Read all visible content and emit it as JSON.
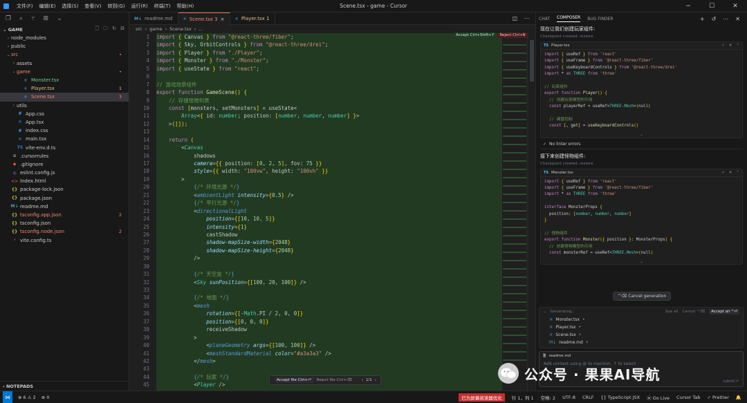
{
  "titlebar": {
    "menus": [
      "文件(F)",
      "编辑(E)",
      "选择(S)",
      "查看(V)",
      "转到(G)",
      "运行(R)",
      "终端(T)",
      "帮助(H)"
    ],
    "title": "Scene.tsx - game - Cursor"
  },
  "explorer": {
    "section": "GAME",
    "outline": "NOTEPADS",
    "items": [
      {
        "label": "node_modules",
        "type": "folder",
        "color": "#cccccc",
        "badge": ""
      },
      {
        "label": "public",
        "type": "folder",
        "color": "#cccccc",
        "badge": ""
      },
      {
        "label": "src",
        "type": "folder-open",
        "color": "#f48771",
        "badge": "•"
      },
      {
        "label": "assets",
        "type": "folder",
        "color": "#cccccc",
        "badge": ""
      },
      {
        "label": "game",
        "type": "folder-open",
        "color": "#f48771",
        "badge": "•"
      },
      {
        "label": "Monster.tsx",
        "type": "tsx",
        "color": "#73c991",
        "badge": ""
      },
      {
        "label": "Player.tsx",
        "type": "tsx",
        "color": "#e2c08d",
        "badge": "1"
      },
      {
        "label": "Scene.tsx",
        "type": "tsx",
        "color": "#f48771",
        "badge": "3"
      },
      {
        "label": "utils",
        "type": "folder",
        "color": "#cccccc",
        "badge": ""
      },
      {
        "label": "App.css",
        "type": "css",
        "color": "#cccccc",
        "badge": ""
      },
      {
        "label": "App.tsx",
        "type": "tsx",
        "color": "#cccccc",
        "badge": ""
      },
      {
        "label": "index.css",
        "type": "css",
        "color": "#cccccc",
        "badge": ""
      },
      {
        "label": "main.tsx",
        "type": "tsx",
        "color": "#cccccc",
        "badge": ""
      },
      {
        "label": "vite-env.d.ts",
        "type": "ts",
        "color": "#cccccc",
        "badge": ""
      },
      {
        "label": ".cursorrules",
        "type": "file",
        "color": "#cccccc",
        "badge": ""
      },
      {
        "label": ".gitignore",
        "type": "git",
        "color": "#cccccc",
        "badge": ""
      },
      {
        "label": "eslint.config.js",
        "type": "eslint",
        "color": "#cccccc",
        "badge": ""
      },
      {
        "label": "index.html",
        "type": "html",
        "color": "#cccccc",
        "badge": ""
      },
      {
        "label": "package-lock.json",
        "type": "json",
        "color": "#cccccc",
        "badge": ""
      },
      {
        "label": "package.json",
        "type": "json",
        "color": "#cccccc",
        "badge": ""
      },
      {
        "label": "readme.md",
        "type": "md",
        "color": "#cccccc",
        "badge": ""
      },
      {
        "label": "tsconfig.app.json",
        "type": "json",
        "color": "#f48771",
        "badge": "2"
      },
      {
        "label": "tsconfig.json",
        "type": "json",
        "color": "#cccccc",
        "badge": ""
      },
      {
        "label": "tsconfig.node.json",
        "type": "json",
        "color": "#f48771",
        "badge": "2"
      },
      {
        "label": "vite.config.ts",
        "type": "vite",
        "color": "#cccccc",
        "badge": ""
      }
    ]
  },
  "tabs": [
    {
      "label": "readme.md",
      "color": "#9d9d9d",
      "badge": "",
      "active": false
    },
    {
      "label": "Scene.tsx 3",
      "color": "#f48771",
      "badge": "×",
      "active": true
    },
    {
      "label": "Player.tsx 1",
      "color": "#e2c08d",
      "badge": "",
      "active": false
    }
  ],
  "breadcrumb": [
    "src",
    "game",
    "Scene.tsx",
    "..."
  ],
  "accept_bar": {
    "accept": "Accept Ctrl+Shift+Y",
    "reject": "Reject Ctrl+N"
  },
  "editor": {
    "start_line": 1,
    "lines": [
      "import { Canvas } from \"@react-three/fiber\";",
      "import { Sky, OrbitControls } from \"@react-three/drei\";",
      "import { Player } from \"./Player\";",
      "import { Monster } from \"./Monster\";",
      "import { useState } from \"react\";",
      "",
      "// 游戏场景组件",
      "export function GameScene() {",
      "    // 存储怪物列表",
      "    const [monsters, setMonsters] = useState<",
      "        Array<{ id: number; position: [number, number, number] }>",
      "    >([]);",
      "",
      "    return (",
      "        <Canvas",
      "            shadows",
      "            camera={{ position: [0, 2, 5], fov: 75 }}",
      "            style={{ width: \"100vw\", height: \"100vh\" }}",
      "        >",
      "            {/* 环境光源 */}",
      "            <ambientLight intensity={0.5} />",
      "            {/* 平行光源 */}",
      "            <directionalLight",
      "                position={[10, 10, 5]}",
      "                intensity={1}",
      "                castShadow",
      "                shadow-mapSize-width={2048}",
      "                shadow-mapSize-height={2048}",
      "            />",
      "",
      "            {/* 天空盒 */}",
      "            <Sky sunPosition={[100, 20, 100]} />",
      "",
      "            {/* 地面 */}",
      "            <mesh",
      "                rotation={[-Math.PI / 2, 0, 0]}",
      "                position={[0, 0, 0]}",
      "                receiveShadow",
      "            >",
      "                <planeGeometry args={[100, 100]} />",
      "                <meshStandardMaterial color=\"#a3a3a3\" />",
      "            </mesh>",
      "",
      "            {/* 玩家 */}",
      "            <Player />",
      ""
    ]
  },
  "accept_file": {
    "accept": "Accept file Ctrl+⏎",
    "reject": "Reject file Ctrl+⌫",
    "nav": "1/1"
  },
  "panel": {
    "tabs": [
      "CHAT",
      "COMPOSER",
      "BUG FINDER"
    ],
    "msg1": "现在让我们创建玩家组件:",
    "checkpoint": "Checkpoint created. restore",
    "card1": {
      "file": "Player.tsx",
      "lines": [
        "import { useRef } from 'react'",
        "import { useFrame } from '@react-three/fiber'",
        "import { useKeyboardControls } from '@react-three/drei'",
        "import * as THREE from 'three'",
        "",
        "// 玩家组件",
        "export function Player() {",
        "  // 创建玩家模型的引用",
        "  const playerRef = useRef<THREE.Mesh>(null)",
        "",
        "  // 键盘控制",
        "  const [, get] = useKeyboardControls()"
      ]
    },
    "lint": "No linter errors",
    "msg2": "接下来创建怪物组件:",
    "checkpoint2": "Checkpoint created. restore",
    "card2": {
      "file": "Monster.tsx",
      "lines": [
        "import { useRef } from 'react'",
        "import { useFrame } from '@react-three/fiber'",
        "import * as THREE from 'three'",
        "",
        "interface MonsterProps {",
        "  position: [number, number, number]",
        "}",
        "",
        "// 怪物组件",
        "export function Monster({ position }: MonsterProps) {",
        "  // 创建怪物模型的引用",
        "  const monsterRef = useRef<THREE.Mesh>(null)"
      ]
    },
    "cancel": "^⌫ Cancel generation",
    "generating": "Generating...",
    "see_all": "See all",
    "cancel_small": "Cancel ^⌫",
    "accept_all": "Accept all ^⏎",
    "gen_files": [
      "Monster.tsx",
      "Player.tsx",
      "Scene.tsx",
      "readme.md"
    ],
    "input_file": "readme.md",
    "input_placeholder": "Add context using @ to mention, ↑ to select",
    "submit": "submit ⏎"
  },
  "watermark": "公众号 · 果果AI导航",
  "statusbar": {
    "errors": "⊗ 6 ⚠ 2",
    "ports": "⊕ 0",
    "red_badge": "已为屏幕阅读器优化",
    "position": "行 1，列 1",
    "spaces": "空格: 2",
    "encoding": "UTF-8",
    "eol": "CRLF",
    "lang": "{} TypeScript JSX",
    "golive": "⦿ Go Live",
    "tab": "Cursor Tab",
    "prettier": "✓ Prettier",
    "bell": "🔔"
  }
}
